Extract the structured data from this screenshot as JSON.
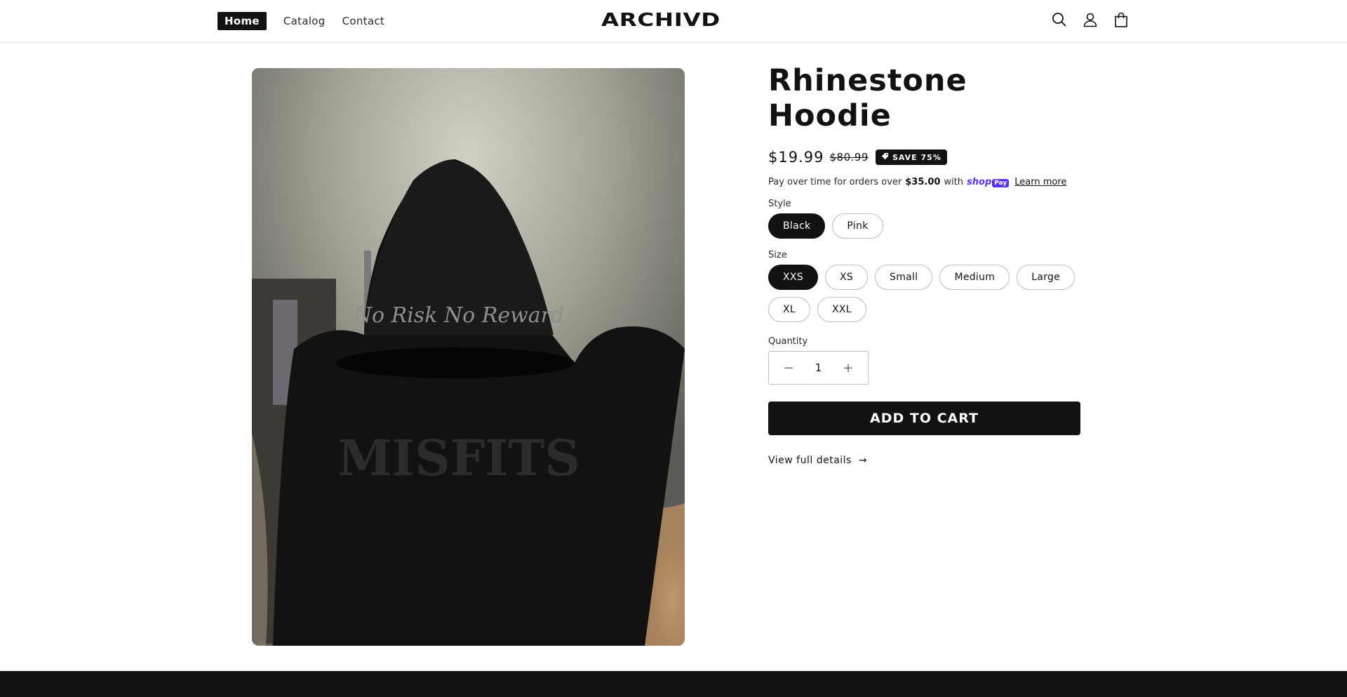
{
  "header": {
    "nav": [
      {
        "label": "Home",
        "active": true
      },
      {
        "label": "Catalog",
        "active": false
      },
      {
        "label": "Contact",
        "active": false
      }
    ],
    "logo": "ARCHIVD",
    "icons": [
      "search-icon",
      "account-icon",
      "cart-icon"
    ]
  },
  "product": {
    "image_text": {
      "hood_print": "No Risk No Reward",
      "back_print": "MISFITS"
    },
    "title": "Rhinestone Hoodie",
    "price": "$19.99",
    "compare_price": "$80.99",
    "badge": "SAVE 75%",
    "shoppay": {
      "prefix": "Pay over time for orders over",
      "amount": "$35.00",
      "with": "with",
      "brand": "shop",
      "brand_suffix": "Pay",
      "learn_more": "Learn more"
    },
    "style": {
      "label": "Style",
      "options": [
        "Black",
        "Pink"
      ],
      "selected": "Black"
    },
    "size": {
      "label": "Size",
      "options_row1": [
        "XXS",
        "XS",
        "Small",
        "Medium",
        "Large"
      ],
      "options_row2": [
        "XL",
        "XXL"
      ],
      "selected": "XXS"
    },
    "quantity": {
      "label": "Quantity",
      "value": "1",
      "minus": "−",
      "plus": "+"
    },
    "add_to_cart": "ADD TO CART",
    "view_details": "View full details",
    "arrow": "→"
  },
  "colors": {
    "primary": "#121212",
    "shoppay": "#5a31f4",
    "background": "#ffffff"
  }
}
